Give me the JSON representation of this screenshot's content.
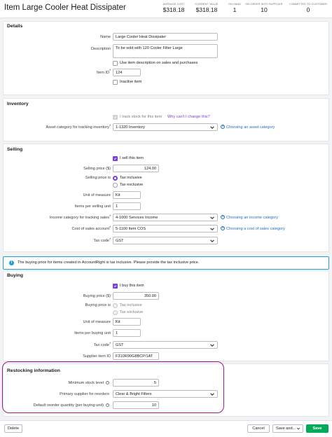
{
  "header": {
    "title": "Item Large Cooler Heat Dissipater",
    "stats": [
      {
        "label": "AVERAGE COST",
        "value": "$318.18"
      },
      {
        "label": "CURRENT VALUE",
        "value": "$318.18"
      },
      {
        "label": "ON HAND",
        "value": "1"
      },
      {
        "label": "ON ORDER WITH SUPPLIER",
        "value": "10"
      },
      {
        "label": "COMMITTED TO CUSTOMER",
        "value": "0"
      }
    ]
  },
  "details": {
    "heading": "Details",
    "name_label": "Name",
    "name_value": "Large Cooler Heat Dissipater",
    "description_label": "Description",
    "description_value": "To be sold with 120 Cooler Filter Large",
    "use_desc_label": "Use item description on sales and purchases",
    "item_id_label": "Item ID",
    "item_id_value": "124",
    "inactive_label": "Inactive item"
  },
  "inventory": {
    "heading": "Inventory",
    "track_label": "I track stock for this item",
    "why_link": "Why can't I change this?",
    "asset_label": "Asset category for tracking inventory",
    "asset_value": "1-1320  Inventory",
    "asset_help": "Choosing an asset category"
  },
  "selling": {
    "heading": "Selling",
    "sell_label": "I sell this item",
    "price_label": "Selling price ($)",
    "price_value": "124.00",
    "price_is_label": "Selling price is",
    "tax_inclusive": "Tax inclusive",
    "tax_exclusive": "Tax exclusive",
    "uom_label": "Unit of measure",
    "uom_value": "Kit",
    "items_per_label": "Items per selling unit",
    "items_per_value": "1",
    "income_label": "Income category for tracking sales",
    "income_value": "4-1000  Services Income",
    "income_help": "Choosing an income category",
    "cos_label": "Cost of sales account",
    "cos_value": "5-1100  Item COS",
    "cos_help": "Choosing a cost of sales category",
    "tax_code_label": "Tax code",
    "tax_code_value": "GST"
  },
  "notice": {
    "text": "The buying price for items created in AccountRight is tax inclusive. Please provide the tax inclusive price."
  },
  "buying": {
    "heading": "Buying",
    "buy_label": "I buy this item",
    "price_label": "Buying price ($)",
    "price_value": "350.00",
    "price_is_label": "Buying price is",
    "tax_inclusive": "Tax inclusive",
    "tax_exclusive": "Tax exclusive",
    "uom_label": "Unit of measure",
    "uom_value": "Kit",
    "items_per_label": "Items per buying unit",
    "items_per_value": "1",
    "tax_code_label": "Tax code",
    "tax_code_value": "GST",
    "supplier_id_label": "Supplier item ID",
    "supplier_id_value": "F310R90G8BCP/1AT"
  },
  "restocking": {
    "heading": "Restocking information",
    "min_label": "Minimum stock level",
    "min_value": "5",
    "supplier_label": "Primary supplier for reorders",
    "supplier_value": "Clear & Bright Filters",
    "reorder_label": "Default reorder quantity (per buying unit)",
    "reorder_value": "10"
  },
  "footer": {
    "delete": "Delete",
    "cancel": "Cancel",
    "save_and": "Save and...",
    "save": "Save"
  },
  "colors": {
    "accent": "#7b3fe4",
    "save_green": "#00aa5b",
    "link_blue": "#1f6ebf",
    "highlight": "#a31a84"
  }
}
